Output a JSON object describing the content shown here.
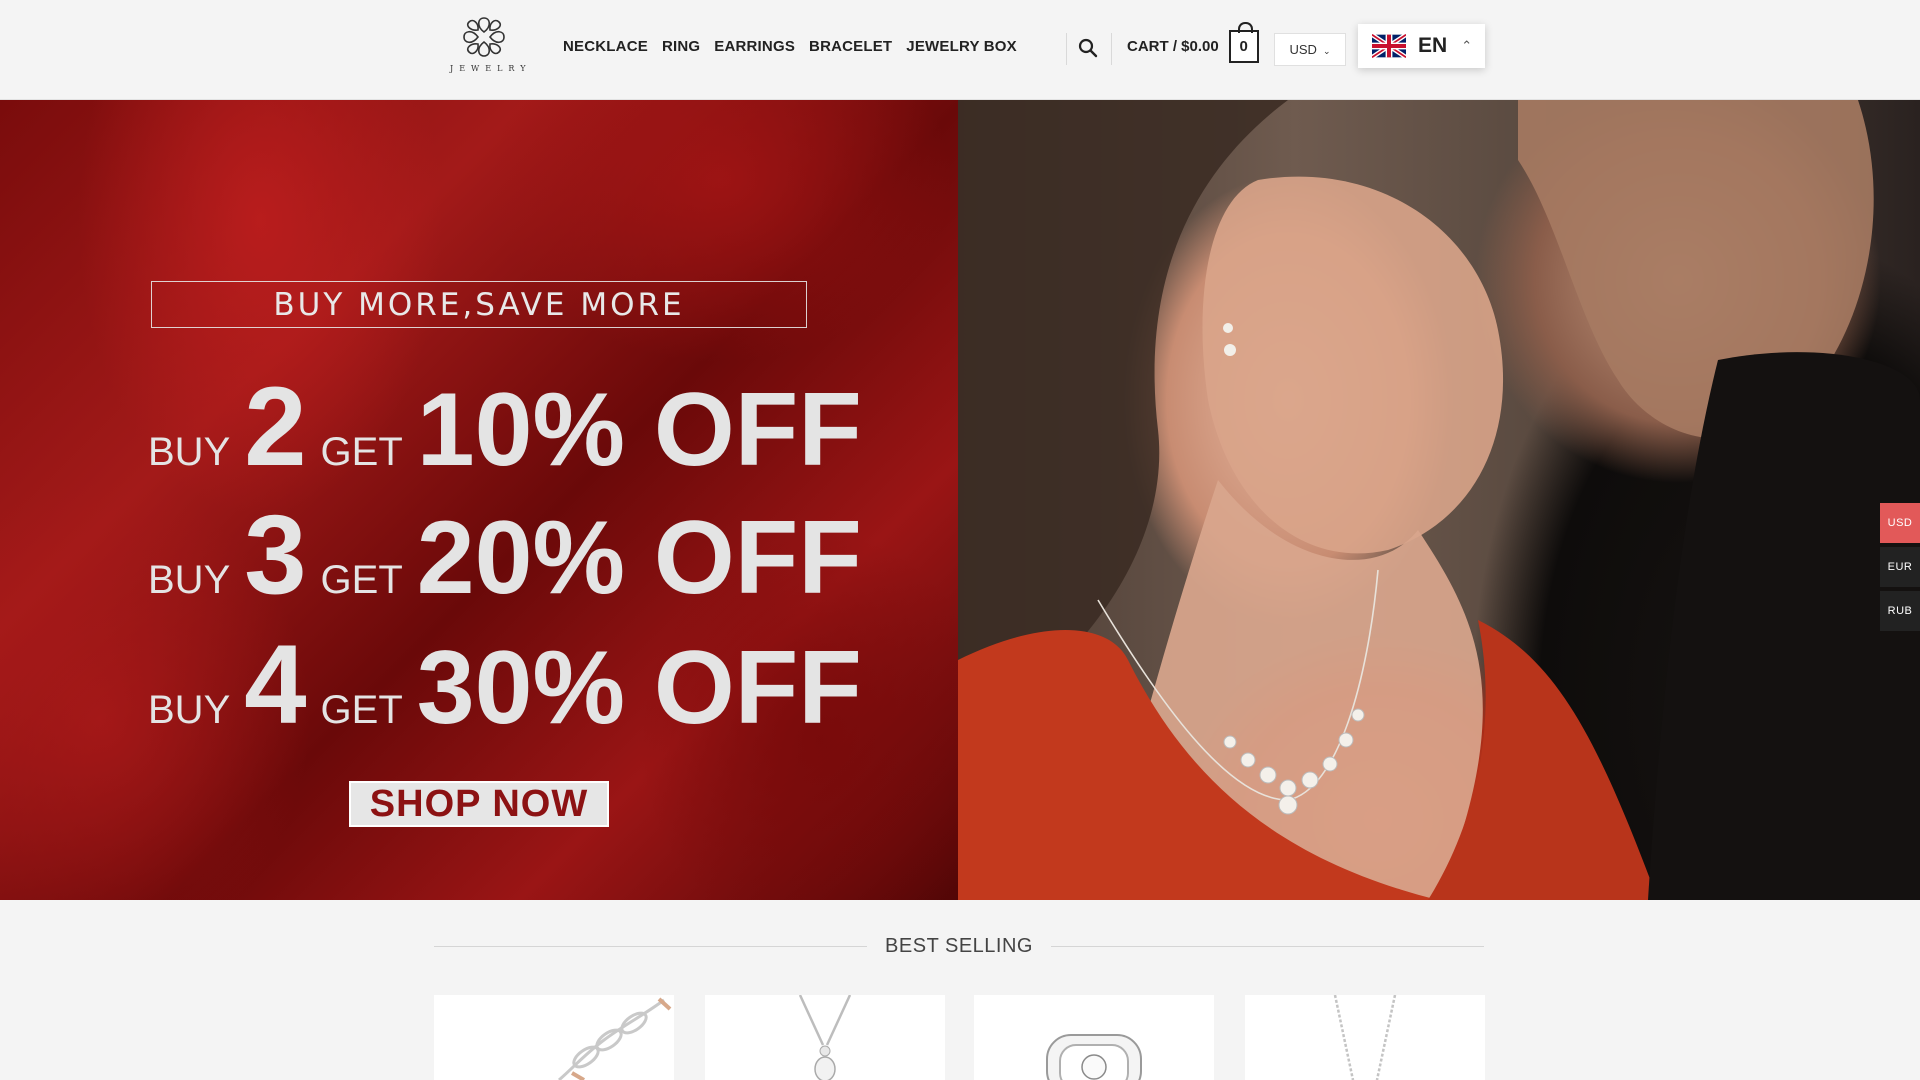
{
  "brand": {
    "logo_text": "JEWELRY"
  },
  "nav": {
    "items": [
      "NECKLACE",
      "RING",
      "EARRINGS",
      "BRACELET",
      "JEWELRY BOX"
    ]
  },
  "header": {
    "search_icon": "search-icon",
    "cart_label": "CART / $0.00",
    "cart_count": "0",
    "currency": "USD",
    "language": "EN"
  },
  "hero": {
    "promo_title": "BUY MORE,SAVE MORE",
    "offers": [
      {
        "buy": "BUY",
        "qty": "2",
        "get": "GET",
        "discount": "10% OFF"
      },
      {
        "buy": "BUY",
        "qty": "3",
        "get": "GET",
        "discount": "20% OFF"
      },
      {
        "buy": "BUY",
        "qty": "4",
        "get": "GET",
        "discount": "30% OFF"
      }
    ],
    "cta": "SHOP NOW"
  },
  "side_currency": [
    "USD",
    "EUR",
    "RUB"
  ],
  "best_selling": {
    "title": "BEST SELLING"
  },
  "colors": {
    "accent": "#e25959",
    "hero_red": "#8c1213",
    "text_dark": "#222222"
  }
}
